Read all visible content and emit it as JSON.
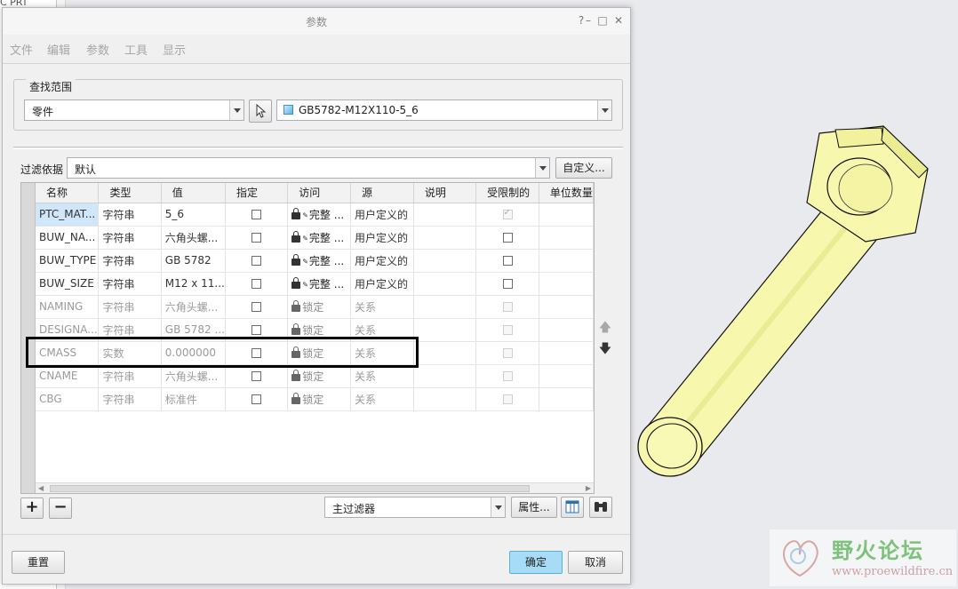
{
  "background": {
    "left_text": "C PRT"
  },
  "dialog": {
    "title": "参数",
    "window_buttons": {
      "help": "?",
      "minimize": "–",
      "maximize": "□",
      "close": "✕"
    },
    "menu": [
      "文件",
      "编辑",
      "参数",
      "工具",
      "显示"
    ],
    "find_scope": {
      "group_title": "查找范围",
      "scope_value": "零件",
      "object_value": "GB5782-M12X110-5_6"
    },
    "filter": {
      "label": "过滤依据",
      "value": "默认",
      "customize_button": "自定义..."
    },
    "table": {
      "columns": [
        "名称",
        "类型",
        "值",
        "指定",
        "访问",
        "源",
        "说明",
        "受限制的",
        "单位数量"
      ],
      "rows": [
        {
          "name": "PTC_MAT...",
          "type": "字符串",
          "value": "5_6",
          "access": "完整",
          "access_more": "...",
          "source": "用户定义的",
          "restricted": true,
          "dim": false,
          "locked": false
        },
        {
          "name": "BUW_NA...",
          "type": "字符串",
          "value": "六角头螺...",
          "access": "完整",
          "access_more": "...",
          "source": "用户定义的",
          "restricted": false,
          "dim": false,
          "locked": false
        },
        {
          "name": "BUW_TYPE",
          "type": "字符串",
          "value": "GB 5782",
          "access": "完整",
          "access_more": "...",
          "source": "用户定义的",
          "restricted": false,
          "dim": false,
          "locked": false
        },
        {
          "name": "BUW_SIZE",
          "type": "字符串",
          "value": "M12 x 11...",
          "access": "完整",
          "access_more": "...",
          "source": "用户定义的",
          "restricted": false,
          "dim": false,
          "locked": false
        },
        {
          "name": "NAMING",
          "type": "字符串",
          "value": "六角头螺...",
          "access": "锁定",
          "access_more": "",
          "source": "关系",
          "restricted": false,
          "dim": true,
          "locked": true
        },
        {
          "name": "DESIGNA...",
          "type": "字符串",
          "value": "GB 5782 ...",
          "access": "锁定",
          "access_more": "",
          "source": "关系",
          "restricted": false,
          "dim": true,
          "locked": true
        },
        {
          "name": "CMASS",
          "type": "实数",
          "value": "0.000000",
          "access": "锁定",
          "access_more": "",
          "source": "关系",
          "restricted": false,
          "dim": true,
          "locked": true
        },
        {
          "name": "CNAME",
          "type": "字符串",
          "value": "六角头螺...",
          "access": "锁定",
          "access_more": "",
          "source": "关系",
          "restricted": false,
          "dim": true,
          "locked": true
        },
        {
          "name": "CBG",
          "type": "字符串",
          "value": "标准件",
          "access": "锁定",
          "access_more": "",
          "source": "关系",
          "restricted": false,
          "dim": true,
          "locked": true
        }
      ]
    },
    "bottom_toolbar": {
      "add": "+",
      "remove": "−",
      "main_filter": "主过滤器",
      "properties_button": "属性..."
    },
    "footer": {
      "reset_button": "重置",
      "ok_button": "确定",
      "cancel_button": "取消"
    }
  },
  "watermark": {
    "title": "野火论坛",
    "url": "www.proewildfire.cn"
  },
  "colors": {
    "accent": "#a6dcf6",
    "bolt": "#f6f6a8",
    "selection": "#cfe6fb"
  }
}
